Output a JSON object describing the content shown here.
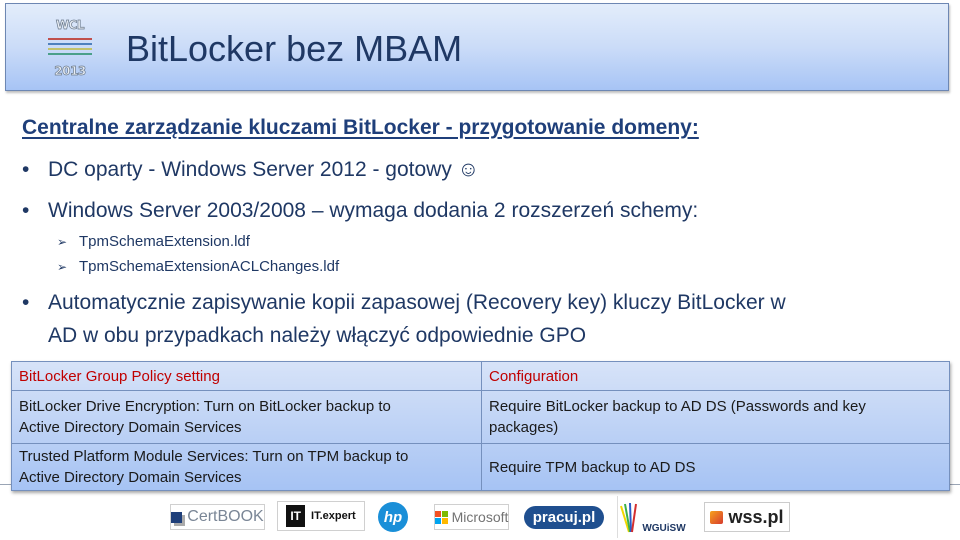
{
  "header": {
    "logo": {
      "top_text": "WCL",
      "bottom_text": "2013",
      "stripe_colors": [
        "#c0504d",
        "#4f81bd",
        "#c3c26b",
        "#4aa08a"
      ]
    },
    "title": "BitLocker bez MBAM"
  },
  "content": {
    "heading": "Centralne zarządzanie kluczami BitLocker - przygotowanie domeny:",
    "bullet_marker": "•",
    "bullets": [
      {
        "text": "DC oparty - Windows Server 2012  - gotowy ☺"
      },
      {
        "text": "Windows Server 2003/2008 – wymaga dodania 2 rozszerzeń schemy:"
      },
      {
        "line1": "Automatycznie zapisywanie kopii zapasowej (Recovery key) kluczy BitLocker w",
        "line2": "AD w obu przypadkach należy włączyć odpowiednie GPO"
      }
    ],
    "sub_marker": "➢",
    "sub_items": [
      {
        "text": "TpmSchemaExtension.ldf"
      },
      {
        "text": "TpmSchemaExtensionACLChanges.ldf"
      }
    ]
  },
  "table": {
    "headers": [
      "BitLocker Group Policy setting",
      "Configuration"
    ],
    "rows": [
      {
        "setting_line1": "BitLocker Drive Encryption: Turn on BitLocker backup to",
        "setting_line2": "Active Directory Domain Services",
        "config_line1": "Require BitLocker backup to AD DS (Passwords and key",
        "config_line2": "packages)"
      },
      {
        "setting_line1": "Trusted Platform Module Services: Turn on TPM backup to",
        "setting_line2": "Active Directory Domain Services",
        "config_line1": "Require TPM backup to AD DS",
        "config_line2": ""
      }
    ]
  },
  "sponsors": [
    {
      "name": "CertBOOK"
    },
    {
      "name": "IT.expert",
      "badge": "IT"
    },
    {
      "name": "hp"
    },
    {
      "name": "Microsoft"
    },
    {
      "name": "pracuj.pl"
    },
    {
      "name": "WGUiSW"
    },
    {
      "name": "wss.pl"
    }
  ]
}
